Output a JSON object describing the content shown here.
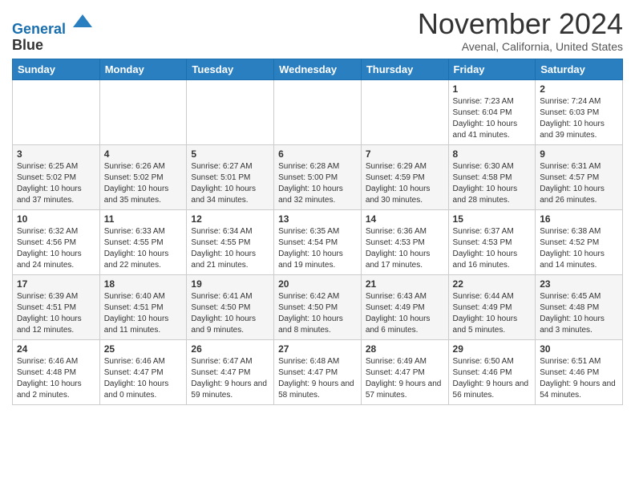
{
  "header": {
    "logo_line1": "General",
    "logo_line2": "Blue",
    "month": "November 2024",
    "location": "Avenal, California, United States"
  },
  "weekdays": [
    "Sunday",
    "Monday",
    "Tuesday",
    "Wednesday",
    "Thursday",
    "Friday",
    "Saturday"
  ],
  "weeks": [
    [
      {
        "day": "",
        "info": ""
      },
      {
        "day": "",
        "info": ""
      },
      {
        "day": "",
        "info": ""
      },
      {
        "day": "",
        "info": ""
      },
      {
        "day": "",
        "info": ""
      },
      {
        "day": "1",
        "info": "Sunrise: 7:23 AM\nSunset: 6:04 PM\nDaylight: 10 hours and 41 minutes."
      },
      {
        "day": "2",
        "info": "Sunrise: 7:24 AM\nSunset: 6:03 PM\nDaylight: 10 hours and 39 minutes."
      }
    ],
    [
      {
        "day": "3",
        "info": "Sunrise: 6:25 AM\nSunset: 5:02 PM\nDaylight: 10 hours and 37 minutes."
      },
      {
        "day": "4",
        "info": "Sunrise: 6:26 AM\nSunset: 5:02 PM\nDaylight: 10 hours and 35 minutes."
      },
      {
        "day": "5",
        "info": "Sunrise: 6:27 AM\nSunset: 5:01 PM\nDaylight: 10 hours and 34 minutes."
      },
      {
        "day": "6",
        "info": "Sunrise: 6:28 AM\nSunset: 5:00 PM\nDaylight: 10 hours and 32 minutes."
      },
      {
        "day": "7",
        "info": "Sunrise: 6:29 AM\nSunset: 4:59 PM\nDaylight: 10 hours and 30 minutes."
      },
      {
        "day": "8",
        "info": "Sunrise: 6:30 AM\nSunset: 4:58 PM\nDaylight: 10 hours and 28 minutes."
      },
      {
        "day": "9",
        "info": "Sunrise: 6:31 AM\nSunset: 4:57 PM\nDaylight: 10 hours and 26 minutes."
      }
    ],
    [
      {
        "day": "10",
        "info": "Sunrise: 6:32 AM\nSunset: 4:56 PM\nDaylight: 10 hours and 24 minutes."
      },
      {
        "day": "11",
        "info": "Sunrise: 6:33 AM\nSunset: 4:55 PM\nDaylight: 10 hours and 22 minutes."
      },
      {
        "day": "12",
        "info": "Sunrise: 6:34 AM\nSunset: 4:55 PM\nDaylight: 10 hours and 21 minutes."
      },
      {
        "day": "13",
        "info": "Sunrise: 6:35 AM\nSunset: 4:54 PM\nDaylight: 10 hours and 19 minutes."
      },
      {
        "day": "14",
        "info": "Sunrise: 6:36 AM\nSunset: 4:53 PM\nDaylight: 10 hours and 17 minutes."
      },
      {
        "day": "15",
        "info": "Sunrise: 6:37 AM\nSunset: 4:53 PM\nDaylight: 10 hours and 16 minutes."
      },
      {
        "day": "16",
        "info": "Sunrise: 6:38 AM\nSunset: 4:52 PM\nDaylight: 10 hours and 14 minutes."
      }
    ],
    [
      {
        "day": "17",
        "info": "Sunrise: 6:39 AM\nSunset: 4:51 PM\nDaylight: 10 hours and 12 minutes."
      },
      {
        "day": "18",
        "info": "Sunrise: 6:40 AM\nSunset: 4:51 PM\nDaylight: 10 hours and 11 minutes."
      },
      {
        "day": "19",
        "info": "Sunrise: 6:41 AM\nSunset: 4:50 PM\nDaylight: 10 hours and 9 minutes."
      },
      {
        "day": "20",
        "info": "Sunrise: 6:42 AM\nSunset: 4:50 PM\nDaylight: 10 hours and 8 minutes."
      },
      {
        "day": "21",
        "info": "Sunrise: 6:43 AM\nSunset: 4:49 PM\nDaylight: 10 hours and 6 minutes."
      },
      {
        "day": "22",
        "info": "Sunrise: 6:44 AM\nSunset: 4:49 PM\nDaylight: 10 hours and 5 minutes."
      },
      {
        "day": "23",
        "info": "Sunrise: 6:45 AM\nSunset: 4:48 PM\nDaylight: 10 hours and 3 minutes."
      }
    ],
    [
      {
        "day": "24",
        "info": "Sunrise: 6:46 AM\nSunset: 4:48 PM\nDaylight: 10 hours and 2 minutes."
      },
      {
        "day": "25",
        "info": "Sunrise: 6:46 AM\nSunset: 4:47 PM\nDaylight: 10 hours and 0 minutes."
      },
      {
        "day": "26",
        "info": "Sunrise: 6:47 AM\nSunset: 4:47 PM\nDaylight: 9 hours and 59 minutes."
      },
      {
        "day": "27",
        "info": "Sunrise: 6:48 AM\nSunset: 4:47 PM\nDaylight: 9 hours and 58 minutes."
      },
      {
        "day": "28",
        "info": "Sunrise: 6:49 AM\nSunset: 4:47 PM\nDaylight: 9 hours and 57 minutes."
      },
      {
        "day": "29",
        "info": "Sunrise: 6:50 AM\nSunset: 4:46 PM\nDaylight: 9 hours and 56 minutes."
      },
      {
        "day": "30",
        "info": "Sunrise: 6:51 AM\nSunset: 4:46 PM\nDaylight: 9 hours and 54 minutes."
      }
    ]
  ]
}
